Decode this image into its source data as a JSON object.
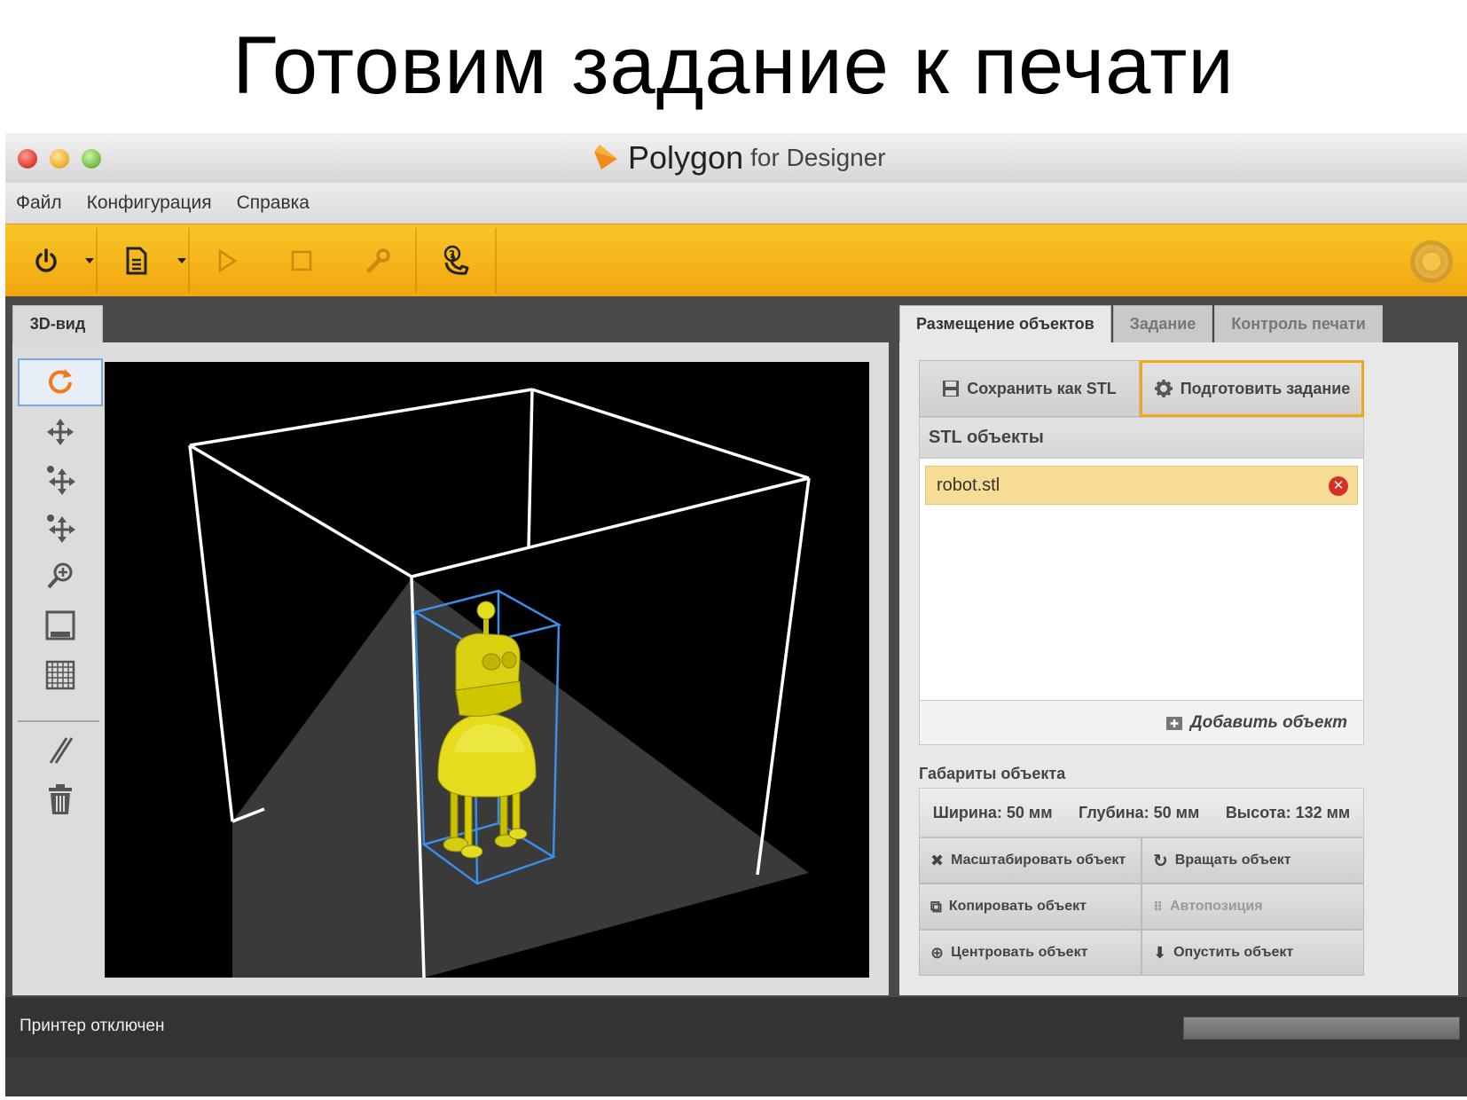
{
  "slide": {
    "title": "Готовим задание к печати"
  },
  "window": {
    "app_name": "Polygon",
    "app_subtitle": "for Designer"
  },
  "menu": {
    "items": [
      "Файл",
      "Конфигурация",
      "Справка"
    ]
  },
  "toolbar": {
    "buttons": [
      "power-icon",
      "file-icon",
      "play-icon",
      "stop-icon",
      "wrench-icon",
      "support-phone-icon"
    ]
  },
  "left": {
    "tab_label": "3D-вид",
    "tools": [
      "rotate-icon",
      "move-icon",
      "move-up-icon",
      "move-down-icon",
      "zoom-icon",
      "floppy-icon",
      "grid-icon",
      "slash-icon",
      "trash-icon"
    ]
  },
  "right": {
    "tabs": [
      "Размещение объектов",
      "Задание",
      "Контроль печати"
    ],
    "save_stl": "Сохранить как STL",
    "prepare_job": "Подготовить задание",
    "stl_header": "STL объекты",
    "stl_items": [
      "robot.stl"
    ],
    "add_object": "Добавить объект",
    "dims_label": "Габариты объекта",
    "width": "Ширина: 50 мм",
    "depth": "Глубина: 50 мм",
    "height": "Высота: 132 мм",
    "ops": {
      "scale": "Масштабировать объект",
      "rotate": "Вращать объект",
      "copy": "Копировать объект",
      "autopos": "Автопозиция",
      "center": "Центровать объект",
      "drop": "Опустить объект"
    }
  },
  "status": {
    "text": "Принтер отключен"
  },
  "colors": {
    "accent": "#f5b41a",
    "highlight": "#f0a818",
    "model": "#e8e020",
    "bbox": "#3a8ee8"
  }
}
